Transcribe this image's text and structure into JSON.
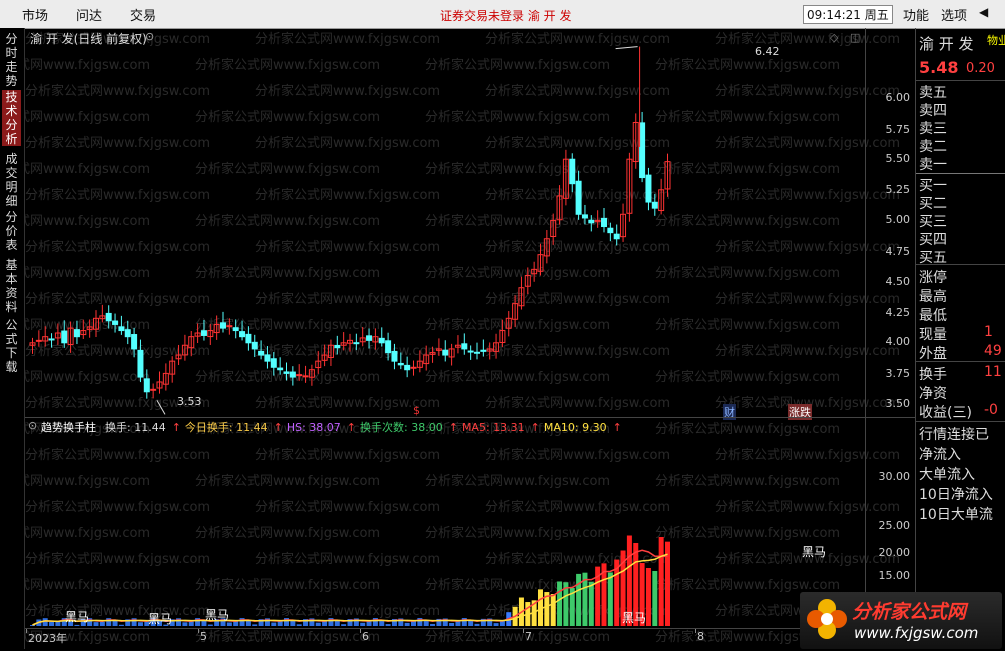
{
  "topbar": {
    "menus": [
      "市场",
      "问达",
      "交易"
    ],
    "notice": "证券交易未登录  渝 开 发",
    "time": "09:14:21 周五",
    "right_menus": [
      "功能",
      "选项"
    ]
  },
  "left_tabs": [
    "分时走势",
    "技术分析",
    "成交明细",
    "分价表",
    "基本资料",
    "公式下载"
  ],
  "chart": {
    "title": "渝 开 发(日线 前复权)",
    "high_label": "6.42",
    "low_label": "3.53",
    "yaxis_top": [
      "6.00",
      "5.75",
      "5.50",
      "5.25",
      "5.00",
      "4.75",
      "4.50",
      "4.25",
      "4.00",
      "3.75",
      "3.50"
    ],
    "markers": [
      "$",
      "财",
      "涨跌"
    ]
  },
  "indicator": {
    "name": "趋势换手柱",
    "items": [
      {
        "label": "换手: 11.44",
        "color": "#dddddd"
      },
      {
        "label": "今日换手: 11.44",
        "color": "#f7c948"
      },
      {
        "label": "HS: 38.07",
        "color": "#c060ff"
      },
      {
        "label": "换手次数: 38.00",
        "color": "#3ec96a"
      },
      {
        "label": "MA5: 13.31",
        "color": "#ff4040"
      },
      {
        "label": "MA10: 9.30",
        "color": "#ffe040"
      }
    ],
    "yaxis": [
      "30.00",
      "25.00",
      "20.00",
      "15.00",
      "10.00"
    ],
    "tags": [
      "黑马",
      "黑马",
      "黑马",
      "黑马",
      "黑马"
    ]
  },
  "xaxis": [
    "2023年",
    "5",
    "6",
    "7",
    "8"
  ],
  "right_panel": {
    "name": "渝 开 发",
    "tag": "物业",
    "price": "5.48",
    "change": "0.20",
    "sell": [
      "卖五",
      "卖四",
      "卖三",
      "卖二",
      "卖一"
    ],
    "buy": [
      "买一",
      "买二",
      "买三",
      "买四",
      "买五"
    ],
    "stats": [
      "涨停",
      "最高",
      "最低",
      "现量",
      "外盘"
    ],
    "stats_vals": [
      "",
      "",
      "",
      "1",
      "49"
    ],
    "extra": [
      "换手",
      "净资",
      "收益(三)"
    ],
    "extra_vals": [
      "11",
      "",
      "-0"
    ],
    "flow": [
      "行情连接已",
      "净流入",
      "大单流入",
      "10日净流入",
      "10日大单流"
    ]
  },
  "logo": {
    "text": "分析家公式网",
    "url": "www.fxjgsw.com"
  },
  "watermark": "分析家公式网www.fxjgsw.com"
}
